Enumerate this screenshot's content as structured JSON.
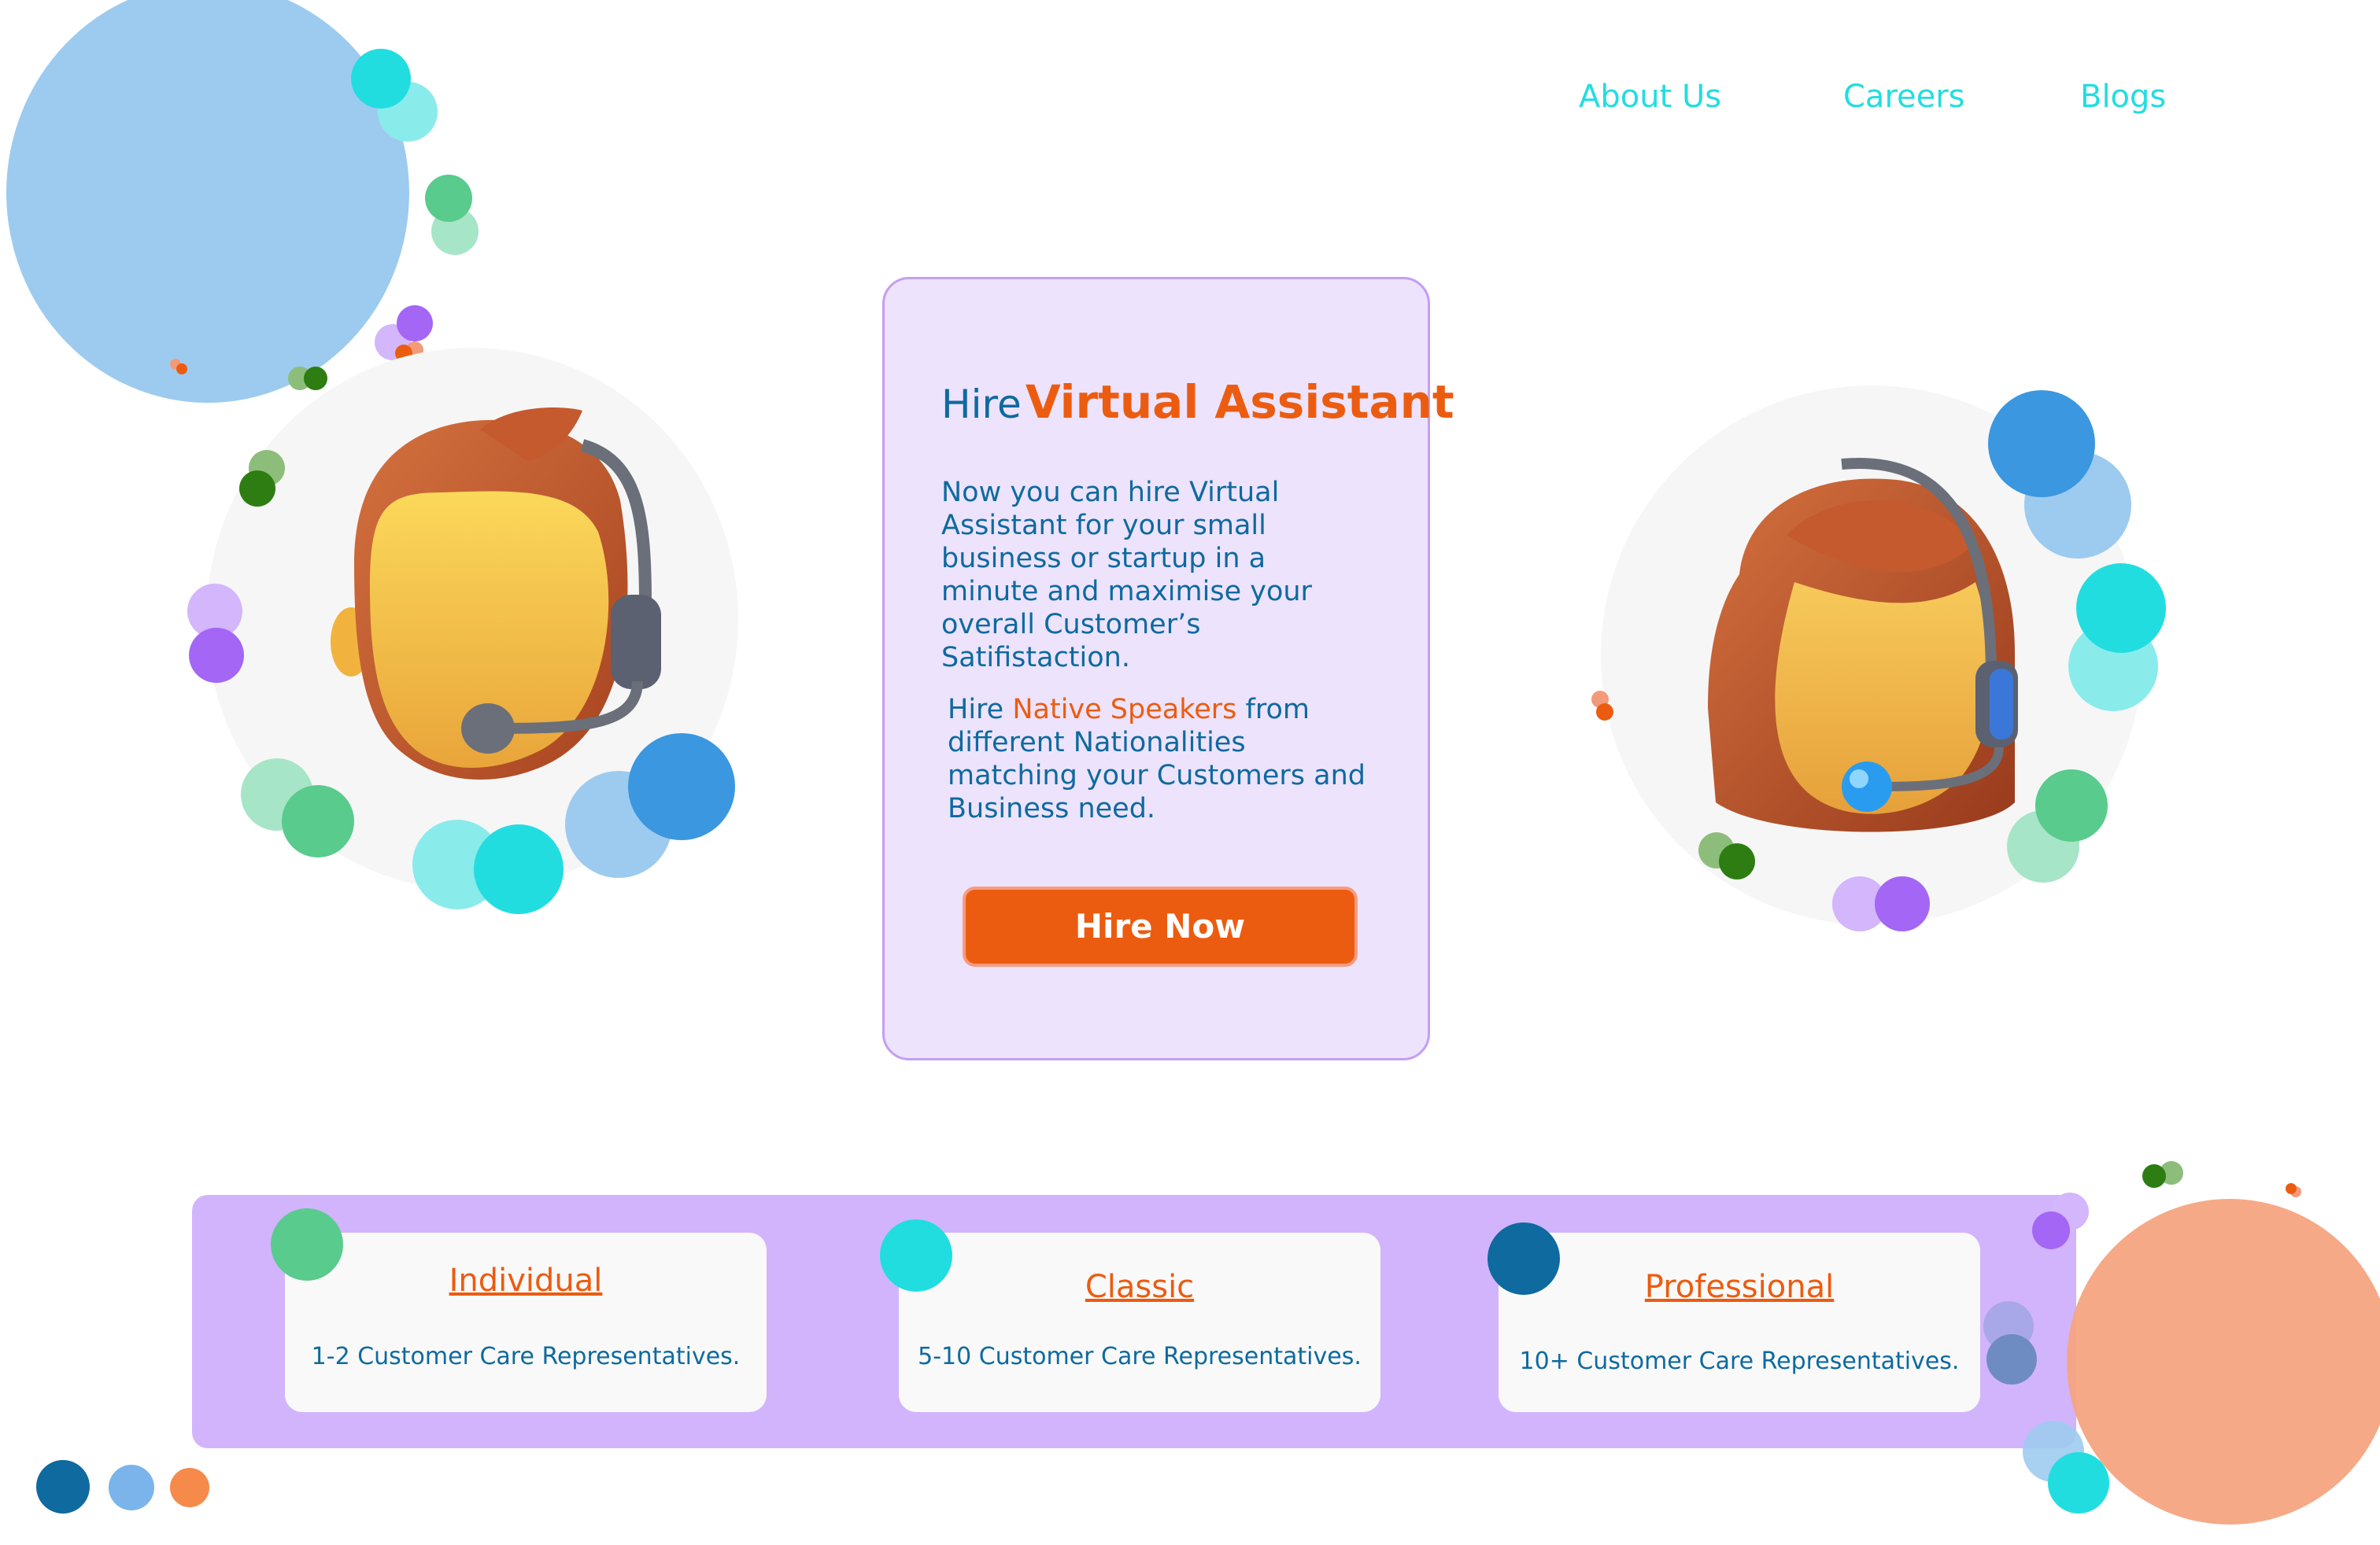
{
  "nav": {
    "items": [
      "About Us",
      "Careers",
      "Blogs"
    ]
  },
  "hero": {
    "title_prefix": "Hire",
    "title_highlight": "Virtual Assistant",
    "description": "Now you can hire Virtual Assistant for your small business or startup in a minute and maximise your overall Customer’s Satifistaction.",
    "native_prefix": "Hire",
    "native_highlight": "Native Speakers",
    "native_suffix": "from different Nationalities matching your Customers and Business need.",
    "cta_label": "Hire Now"
  },
  "plans": [
    {
      "title": "Individual",
      "description": "1-2 Customer Care Representatives."
    },
    {
      "title": "Classic",
      "description": "5-10 Customer Care Representatives."
    },
    {
      "title": "Professional",
      "description": "10+ Customer Care Representatives."
    }
  ],
  "icons": {
    "male_agent": "male-support-agent-icon",
    "female_agent": "female-support-agent-icon"
  },
  "colors": {
    "accent": "#ec5c10",
    "text_blue": "#0e6a9f",
    "nav_cyan": "#22dde0",
    "card_bg": "#ede3fd",
    "plans_bg": "#d2b4fd"
  }
}
